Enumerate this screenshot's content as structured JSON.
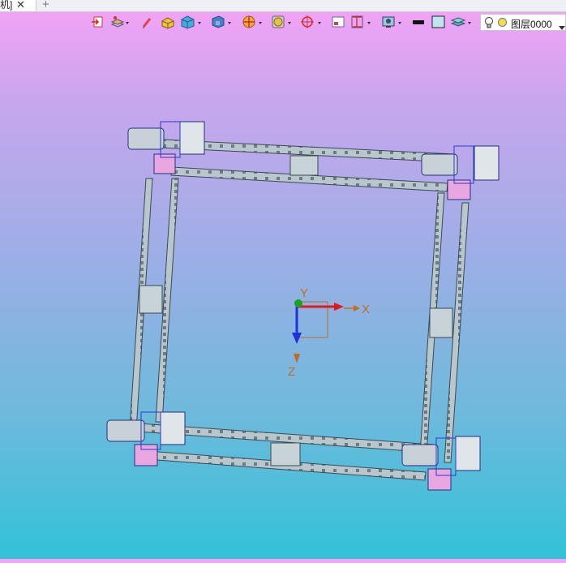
{
  "tab": {
    "title": "机]",
    "close": "✕",
    "new_tab": "+"
  },
  "layer": {
    "label": "图层0000"
  },
  "axes": {
    "x": "X",
    "y": "Y",
    "z": "Z"
  },
  "icons": [
    "exit-icon",
    "layer-manage-icon",
    "pencil-icon",
    "solid-box-icon",
    "shaded-cube-icon",
    "view-orient-icon",
    "section-icon",
    "render-icon",
    "snap-target-icon",
    "frame-icon",
    "dimension-icon",
    "display-settings-icon",
    "line-color-icon",
    "fill-color-icon",
    "layer-stack-icon"
  ]
}
